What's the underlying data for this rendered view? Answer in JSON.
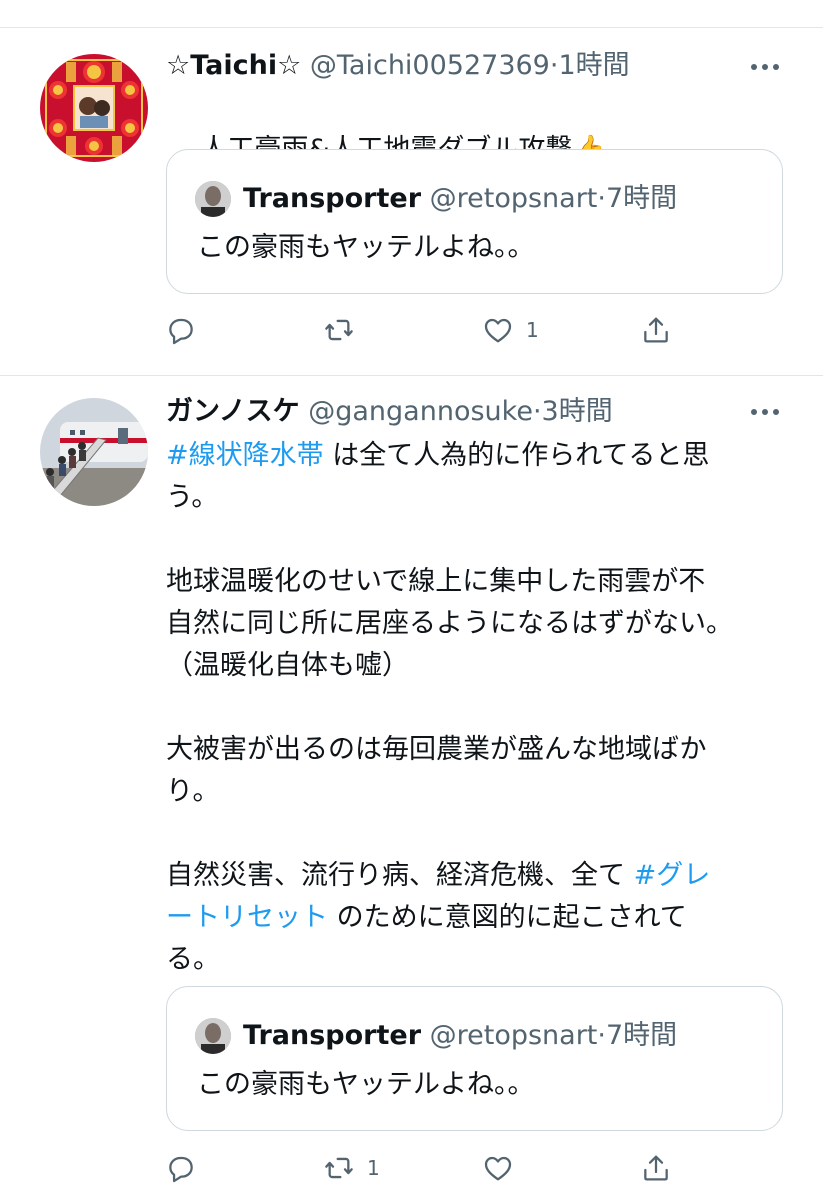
{
  "tweets": [
    {
      "display_name": "☆Taichi☆",
      "handle": "@Taichi00527369",
      "separator": "·",
      "time": "1時間",
      "avatar_icon": "lucky-charm-avatar-icon",
      "text_parts": [
        {
          "text": "人工豪雨&人工地震ダブル攻撃",
          "hashtag": false
        }
      ],
      "emoji": "👍",
      "quote": {
        "display_name": "Transporter",
        "handle": "@retopsnart",
        "separator": "·",
        "time": "7時間",
        "text": "この豪雨もヤッテルよね。。"
      },
      "actions": {
        "reply_count": "",
        "retweet_count": "",
        "like_count": "1"
      }
    },
    {
      "display_name": "ガンノスケ",
      "handle": "@gangannosuke",
      "separator": "·",
      "time": "3時間",
      "avatar_icon": "airplane-boarding-avatar-icon",
      "body_lines": [
        {
          "segments": [
            {
              "text": "#線状降水帯",
              "hashtag": true
            },
            {
              "text": " は全て人為的に作られてると思",
              "hashtag": false
            }
          ]
        },
        {
          "segments": [
            {
              "text": "う。",
              "hashtag": false
            }
          ]
        },
        {
          "segments": [
            {
              "text": "",
              "hashtag": false
            }
          ]
        },
        {
          "segments": [
            {
              "text": "地球温暖化のせいで線上に集中した雨雲が不",
              "hashtag": false
            }
          ]
        },
        {
          "segments": [
            {
              "text": "自然に同じ所に居座るようになるはずがない。",
              "hashtag": false
            }
          ]
        },
        {
          "segments": [
            {
              "text": "（温暖化自体も嘘）",
              "hashtag": false
            }
          ]
        },
        {
          "segments": [
            {
              "text": "",
              "hashtag": false
            }
          ]
        },
        {
          "segments": [
            {
              "text": "大被害が出るのは毎回農業が盛んな地域ばか",
              "hashtag": false
            }
          ]
        },
        {
          "segments": [
            {
              "text": "り。",
              "hashtag": false
            }
          ]
        },
        {
          "segments": [
            {
              "text": "",
              "hashtag": false
            }
          ]
        },
        {
          "segments": [
            {
              "text": "自然災害、流行り病、経済危機、全て ",
              "hashtag": false
            },
            {
              "text": "#グレ",
              "hashtag": true
            }
          ]
        },
        {
          "segments": [
            {
              "text": "ートリセット",
              "hashtag": true
            },
            {
              "text": " のために意図的に起こされて",
              "hashtag": false
            }
          ]
        },
        {
          "segments": [
            {
              "text": "る。",
              "hashtag": false
            }
          ]
        }
      ],
      "quote": {
        "display_name": "Transporter",
        "handle": "@retopsnart",
        "separator": "·",
        "time": "7時間",
        "text": "この豪雨もヤッテルよね。。"
      },
      "actions": {
        "reply_count": "",
        "retweet_count": "1",
        "like_count": ""
      }
    }
  ],
  "icons": {
    "more": "more-icon",
    "reply": "reply-icon",
    "retweet": "retweet-icon",
    "like": "heart-icon",
    "share": "share-icon"
  },
  "colors": {
    "text": "#0f1419",
    "secondary": "#536471",
    "hashtag": "#1d9bf0",
    "divider": "#e1e6ea",
    "quote_border": "#cfd9de"
  }
}
